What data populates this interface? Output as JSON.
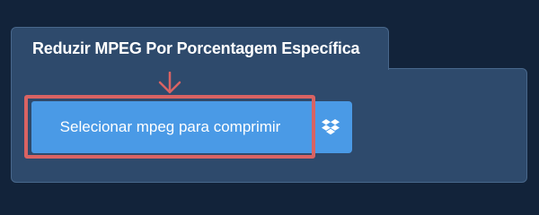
{
  "converter": {
    "tab_title": "Reduzir MPEG Por Porcentagem Específica",
    "upload_button_label": "Selecionar mpeg para comprimir",
    "dropbox_icon": "dropbox-icon",
    "arrow_icon": "down-arrow-icon"
  },
  "colors": {
    "background": "#12233a",
    "panel": "#2e4a6c",
    "button": "#4a9ae6",
    "highlight": "#d96363"
  }
}
